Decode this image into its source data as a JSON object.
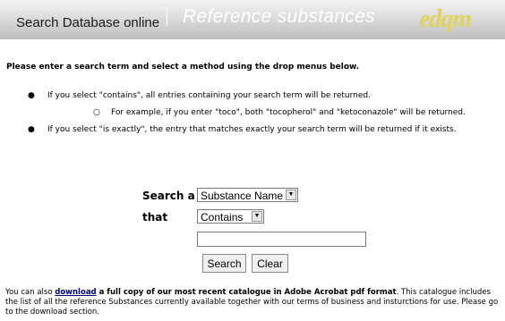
{
  "banner": {
    "title": "Search Database online",
    "separator": "|",
    "subtitle": "Reference substances",
    "logo": "edqm"
  },
  "intro": "Please enter a search term and select a method using the drop menus below.",
  "bullets": {
    "contains": "If you select \"contains\", all entries containing your search term will be returned.",
    "example": "For example, if you enter \"toco\", both \"tocopherol\" and \"ketoconazole\" will be returned.",
    "exact": "If you select \"is exactly\", the entry that matches exactly your search term will be returned if it exists.",
    "bullet_glyph": "●",
    "sub_glyph": "○"
  },
  "form": {
    "search_a_label": "Search a",
    "that_label": "that",
    "field_select_value": "Substance Name",
    "method_select_value": "Contains",
    "search_input_value": "",
    "search_button": "Search",
    "clear_button": "Clear",
    "arrow_glyph": "▼"
  },
  "footer": {
    "lead": "You can also ",
    "link": "download",
    "bold_text": " a full copy of our most recent catalogue in Adobe Acrobat pdf format",
    "rest": ". This catalogue includes the list of all the reference Substances currently available together with our terms of business and insturctions for use. Please go to the download section."
  },
  "colors": {
    "banner_text": "#1a1a1a",
    "banner_subtitle": "#ffffff",
    "logo": "#e1d25b",
    "link": "#000080"
  }
}
